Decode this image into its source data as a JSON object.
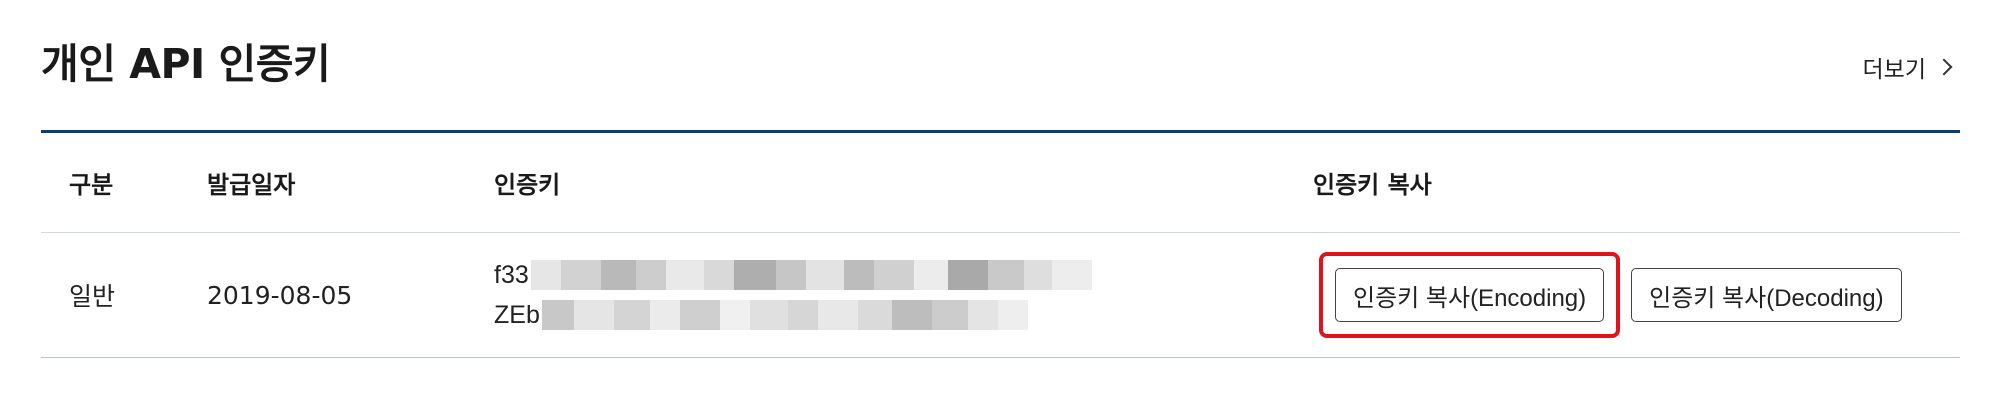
{
  "header": {
    "title": "개인 API 인증키",
    "more_label": "더보기"
  },
  "table": {
    "columns": [
      "구분",
      "발급일자",
      "인증키",
      "인증키 복사"
    ],
    "rows": [
      {
        "type": "일반",
        "issued_date": "2019-08-05",
        "key_line1_visible": "f33",
        "key_line2_visible": "ZEb",
        "key_obscured": true,
        "copy_encoding_label": "인증키 복사(Encoding)",
        "copy_decoding_label": "인증키 복사(Decoding)"
      }
    ]
  },
  "colors": {
    "table_top_border": "#0f3b6e",
    "highlight_border": "#e0121b"
  },
  "icons": {
    "more": "chevron-right-icon"
  }
}
